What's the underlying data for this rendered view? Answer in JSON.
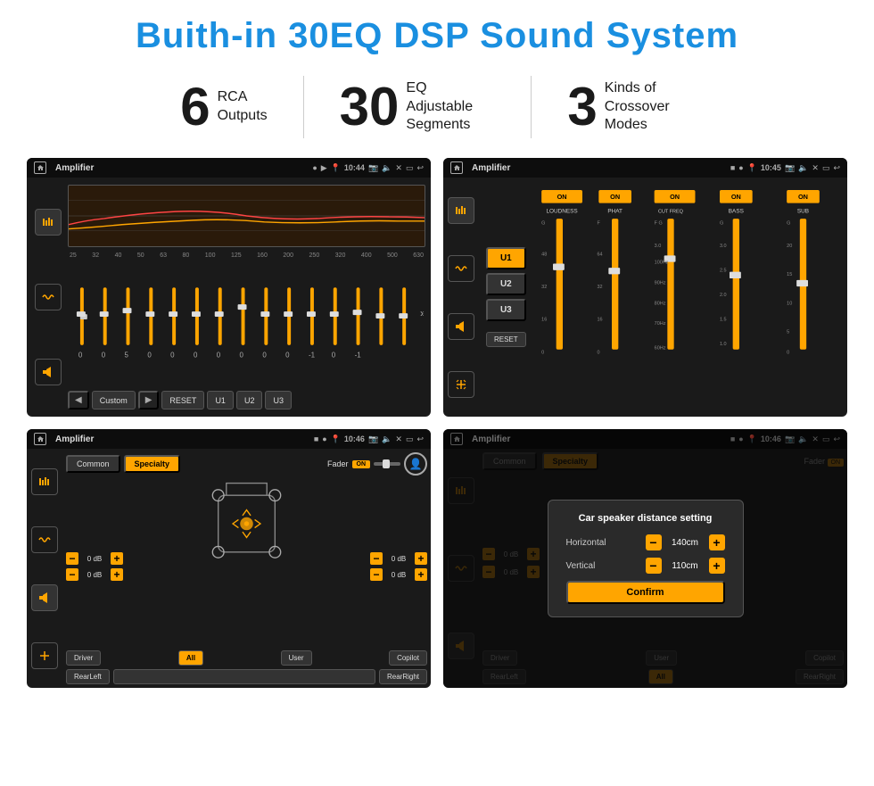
{
  "page": {
    "title": "Buith-in 30EQ DSP Sound System",
    "stats": [
      {
        "number": "6",
        "label": "RCA\nOutputs"
      },
      {
        "number": "30",
        "label": "EQ Adjustable\nSegments"
      },
      {
        "number": "3",
        "label": "Kinds of\nCrossover Modes"
      }
    ]
  },
  "screenshot1": {
    "status": {
      "title": "Amplifier",
      "time": "10:44"
    },
    "eq_frequencies": [
      "25",
      "32",
      "40",
      "50",
      "63",
      "80",
      "100",
      "125",
      "160",
      "200",
      "250",
      "320",
      "400",
      "500",
      "630"
    ],
    "controls": {
      "custom": "Custom",
      "reset": "RESET",
      "u1": "U1",
      "u2": "U2",
      "u3": "U3"
    }
  },
  "screenshot2": {
    "status": {
      "title": "Amplifier",
      "time": "10:45"
    },
    "u_buttons": [
      "U1",
      "U2",
      "U3"
    ],
    "channels": [
      "LOUDNESS",
      "PHAT",
      "CUT FREQ",
      "BASS",
      "SUB"
    ],
    "reset": "RESET"
  },
  "screenshot3": {
    "status": {
      "title": "Amplifier",
      "time": "10:46"
    },
    "tabs": [
      "Common",
      "Specialty"
    ],
    "fader_label": "Fader",
    "fader_on": "ON",
    "controls": {
      "driver": "Driver",
      "copilot": "Copilot",
      "rear_left": "RearLeft",
      "all": "All",
      "user": "User",
      "rear_right": "RearRight"
    },
    "volume_labels": [
      "0 dB",
      "0 dB",
      "0 dB",
      "0 dB"
    ]
  },
  "screenshot4": {
    "status": {
      "title": "Amplifier",
      "time": "10:46"
    },
    "tabs": [
      "Common",
      "Specialty"
    ],
    "dialog": {
      "title": "Car speaker distance setting",
      "horizontal_label": "Horizontal",
      "horizontal_value": "140cm",
      "vertical_label": "Vertical",
      "vertical_value": "110cm",
      "confirm_label": "Confirm"
    },
    "controls": {
      "driver": "Driver",
      "copilot": "Copilot",
      "rear_left": "RearLeft",
      "all": "All",
      "user": "User",
      "rear_right": "RearRight"
    },
    "volume_labels": [
      "0 dB",
      "0 dB"
    ]
  }
}
